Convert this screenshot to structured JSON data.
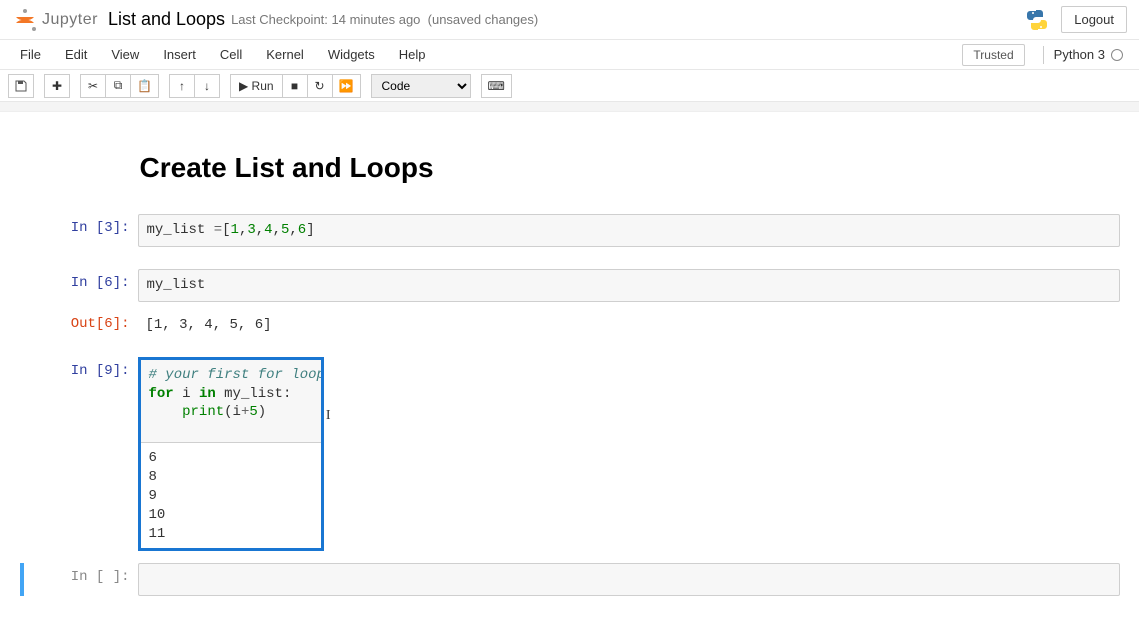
{
  "header": {
    "logo_text": "Jupyter",
    "notebook_title": "List and Loops",
    "checkpoint": "Last Checkpoint: 14 minutes ago",
    "unsaved": "(unsaved changes)",
    "logout": "Logout"
  },
  "menubar": {
    "items": [
      "File",
      "Edit",
      "View",
      "Insert",
      "Cell",
      "Kernel",
      "Widgets",
      "Help"
    ],
    "trusted": "Trusted",
    "kernel": "Python 3"
  },
  "toolbar": {
    "run_label": "Run",
    "cell_type": "Code"
  },
  "notebook": {
    "heading": "Create List and Loops",
    "cells": [
      {
        "prompt_in": "In [3]:",
        "code_tokens": [
          {
            "t": "my_list ",
            "c": ""
          },
          {
            "t": "=",
            "c": "op"
          },
          {
            "t": "[",
            "c": ""
          },
          {
            "t": "1",
            "c": "num"
          },
          {
            "t": ",",
            "c": ""
          },
          {
            "t": "3",
            "c": "num"
          },
          {
            "t": ",",
            "c": ""
          },
          {
            "t": "4",
            "c": "num"
          },
          {
            "t": ",",
            "c": ""
          },
          {
            "t": "5",
            "c": "num"
          },
          {
            "t": ",",
            "c": ""
          },
          {
            "t": "6",
            "c": "num"
          },
          {
            "t": "]",
            "c": ""
          }
        ]
      },
      {
        "prompt_in": "In [6]:",
        "code_plain": "my_list",
        "prompt_out": "Out[6]:",
        "output": "[1, 3, 4, 5, 6]"
      },
      {
        "prompt_in": "In [9]:",
        "code_lines": [
          [
            {
              "t": "# your first for loop",
              "c": "comment"
            }
          ],
          [
            {
              "t": "for",
              "c": "kw"
            },
            {
              "t": " i ",
              "c": ""
            },
            {
              "t": "in",
              "c": "kw"
            },
            {
              "t": " my_list:",
              "c": ""
            }
          ],
          [
            {
              "t": "    ",
              "c": ""
            },
            {
              "t": "print",
              "c": "builtin"
            },
            {
              "t": "(i",
              "c": ""
            },
            {
              "t": "+",
              "c": "op"
            },
            {
              "t": "5",
              "c": "num"
            },
            {
              "t": ")",
              "c": ""
            }
          ]
        ],
        "output_lines": [
          "6",
          "8",
          "9",
          "10",
          "11"
        ]
      },
      {
        "prompt_in": "In [ ]:",
        "code_plain": ""
      }
    ]
  }
}
